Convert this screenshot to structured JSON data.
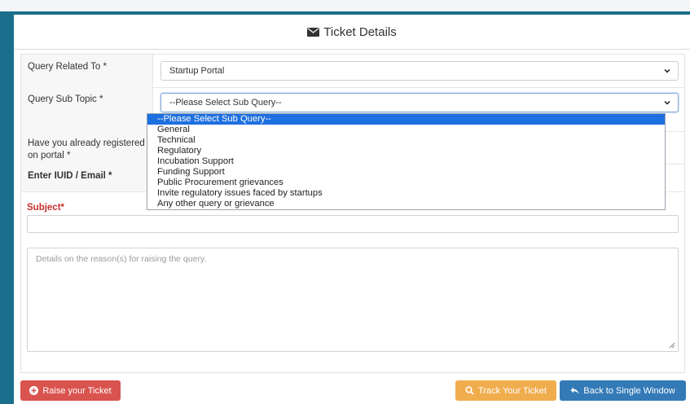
{
  "header": {
    "title": "Ticket Details",
    "icon": "envelope-icon"
  },
  "form": {
    "query_related_label": "Query Related To *",
    "query_related_value": "Startup Portal",
    "sub_topic_label": "Query Sub Topic *",
    "sub_topic_value": "--Please Select Sub Query--",
    "registered_label_1": "Have you already registered",
    "registered_label_2": "on portal *",
    "iuid_label": "Enter IUID / Email *",
    "subject_label": "Subject*",
    "details_placeholder": "Details on the reason(s) for raising the query."
  },
  "dropdown": {
    "options": [
      "--Please Select Sub Query--",
      "General",
      "Technical",
      "Regulatory",
      "Incubation Support",
      "Funding Support",
      "Public Procurement grievances",
      "Invite regulatory issues faced by startups",
      "Any other query or grievance"
    ],
    "selected_index": 0
  },
  "buttons": {
    "raise": "Raise your Ticket",
    "track": "Track Your Ticket",
    "back": "Back to Single Window"
  },
  "colors": {
    "accent_blue": "#337ab7",
    "danger_red": "#d9534f",
    "warning_orange": "#f0ad4e",
    "selection_blue": "#1e6fe0",
    "frame_teal": "#1b6f8c"
  }
}
